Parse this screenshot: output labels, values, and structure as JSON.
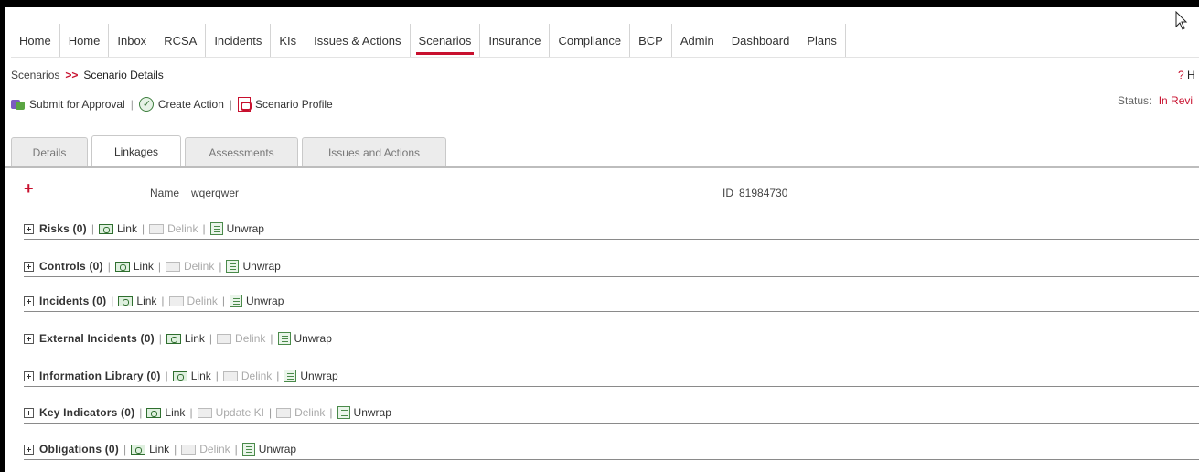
{
  "nav": {
    "items": [
      {
        "label": "Home"
      },
      {
        "label": "Home"
      },
      {
        "label": "Inbox"
      },
      {
        "label": "RCSA"
      },
      {
        "label": "Incidents"
      },
      {
        "label": "KIs"
      },
      {
        "label": "Issues & Actions"
      },
      {
        "label": "Scenarios"
      },
      {
        "label": "Insurance"
      },
      {
        "label": "Compliance"
      },
      {
        "label": "BCP"
      },
      {
        "label": "Admin"
      },
      {
        "label": "Dashboard"
      },
      {
        "label": "Plans"
      }
    ],
    "active": "Scenarios"
  },
  "breadcrumb": {
    "parent": "Scenarios",
    "separator": ">>",
    "current": "Scenario Details"
  },
  "help": {
    "icon": "?",
    "label": "H"
  },
  "status": {
    "label": "Status:",
    "value": "In Revi"
  },
  "actions": {
    "submit": "Submit for Approval",
    "create": "Create Action",
    "profile": "Scenario Profile",
    "separator": "|"
  },
  "tabs": [
    {
      "label": "Details"
    },
    {
      "label": "Linkages"
    },
    {
      "label": "Assessments"
    },
    {
      "label": "Issues and Actions"
    }
  ],
  "active_tab": "Linkages",
  "record": {
    "add_icon": "+",
    "name_label": "Name",
    "name_value": "wqerqwer",
    "id_label": "ID",
    "id_value": "81984730"
  },
  "links": {
    "link": "Link",
    "delink": "Delink",
    "unwrap": "Unwrap",
    "update_ki": "Update KI",
    "pipe": "|"
  },
  "sections": [
    {
      "title": "Risks (0)"
    },
    {
      "title": "Controls (0)"
    },
    {
      "title": "Incidents (0)"
    },
    {
      "title": "External Incidents (0)"
    },
    {
      "title": "Information Library (0)"
    },
    {
      "title": "Key Indicators (0)"
    },
    {
      "title": "Obligations (0)"
    }
  ],
  "colors": {
    "accent": "#c8102e",
    "frame": "#000000"
  }
}
